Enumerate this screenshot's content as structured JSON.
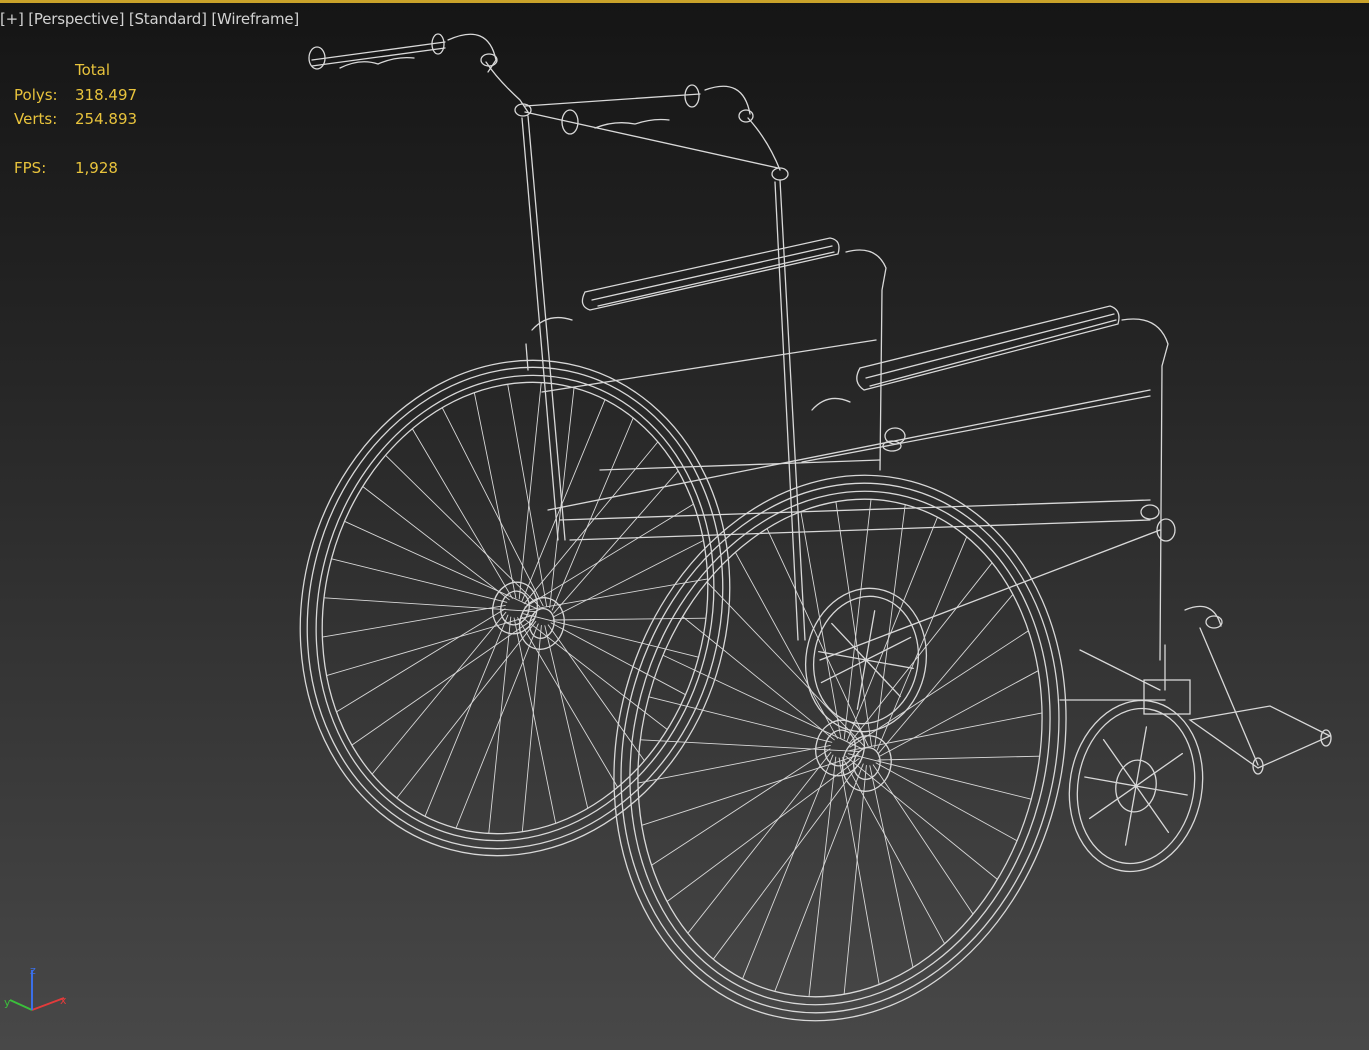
{
  "viewport": {
    "label_plus": "[+]",
    "label_view": "[Perspective]",
    "label_shading": "[Standard]",
    "label_mode": "[Wireframe]"
  },
  "stats": {
    "header": "Total",
    "polys_label": "Polys:",
    "polys_value": "318.497",
    "verts_label": "Verts:",
    "verts_value": "254.893",
    "fps_label": "FPS:",
    "fps_value": "1,928"
  },
  "gizmo": {
    "x_label": "x",
    "y_label": "y",
    "z_label": "z"
  },
  "model": {
    "name": "wheelchair",
    "display": "wireframe"
  },
  "colors": {
    "viewport_border": "#c9a22a",
    "stats_text": "#e8c33c",
    "wire": "#d8d8d8",
    "axis_x": "#e23b3b",
    "axis_y": "#3bbf3b",
    "axis_z": "#3b6fe8"
  }
}
